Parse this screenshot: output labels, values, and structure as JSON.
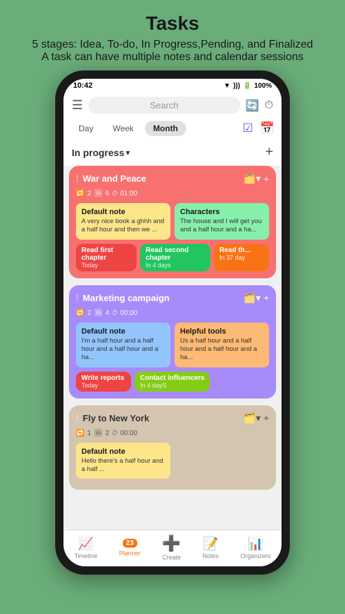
{
  "header": {
    "title": "Tasks",
    "subtitle_line1": "5 stages: Idea, To-do, In Progress,Pending, and Finalized",
    "subtitle_line2": "A task can have multiple notes and calendar sessions"
  },
  "status_bar": {
    "time": "10:42",
    "battery": "100%",
    "icons": "▼ ))) 📶"
  },
  "top_bar": {
    "search_placeholder": "Search",
    "hamburger": "☰"
  },
  "tabs": {
    "items": [
      "Day",
      "Week",
      "Month"
    ],
    "active": "Month"
  },
  "section": {
    "title": "In progress",
    "arrow": "▾",
    "add": "+"
  },
  "tasks": [
    {
      "id": "task1",
      "title": "War and Peace",
      "meta_sessions": "2",
      "meta_notes": "6",
      "meta_time": "01:00",
      "color": "red",
      "notes": [
        {
          "title": "Default note",
          "text": "A very nice book a ghhh and a half hour and then we ...",
          "color": "yellow"
        },
        {
          "title": "Characters",
          "text": "The house and I will get you and a half hour and a ha...",
          "color": "green"
        }
      ],
      "sessions": [
        {
          "label": "Read first chapter",
          "sub": "Today",
          "color": "chip-red"
        },
        {
          "label": "Read second chapter",
          "sub": "In 4 days",
          "color": "chip-green"
        },
        {
          "label": "Read th...",
          "sub": "In 37 day",
          "color": "chip-orange"
        }
      ]
    },
    {
      "id": "task2",
      "title": "Marketing campaign",
      "meta_sessions": "2",
      "meta_notes": "4",
      "meta_time": "00:00",
      "color": "purple",
      "notes": [
        {
          "title": "Default note",
          "text": "I'm a half hour and a half hour and a half hour and a ha...",
          "color": "blue"
        },
        {
          "title": "Helpful tools",
          "text": "Us a half hour and a half hour and a half hour and a ha...",
          "color": "orange"
        }
      ],
      "sessions": [
        {
          "label": "Write reports",
          "sub": "Today",
          "color": "chip-red"
        },
        {
          "label": "Contact influencers",
          "sub": "In 4 dayS",
          "color": "chip-lime"
        }
      ]
    },
    {
      "id": "task3",
      "title": "Fly to New York",
      "meta_sessions": "1",
      "meta_notes": "2",
      "meta_time": "00:00",
      "color": "tan",
      "notes": [
        {
          "title": "Default note",
          "text": "Hello there's a half hour and a half ...",
          "color": "yellow"
        }
      ],
      "sessions": []
    }
  ],
  "bottom_nav": {
    "items": [
      {
        "icon": "📈",
        "label": "Timeline",
        "active": false
      },
      {
        "icon": "📅",
        "label": "Planner",
        "active": true,
        "badge": "23"
      },
      {
        "icon": "➕",
        "label": "Create",
        "active": false
      },
      {
        "icon": "📝",
        "label": "Notes",
        "active": false
      },
      {
        "icon": "📊",
        "label": "Organizers",
        "active": false
      }
    ]
  }
}
